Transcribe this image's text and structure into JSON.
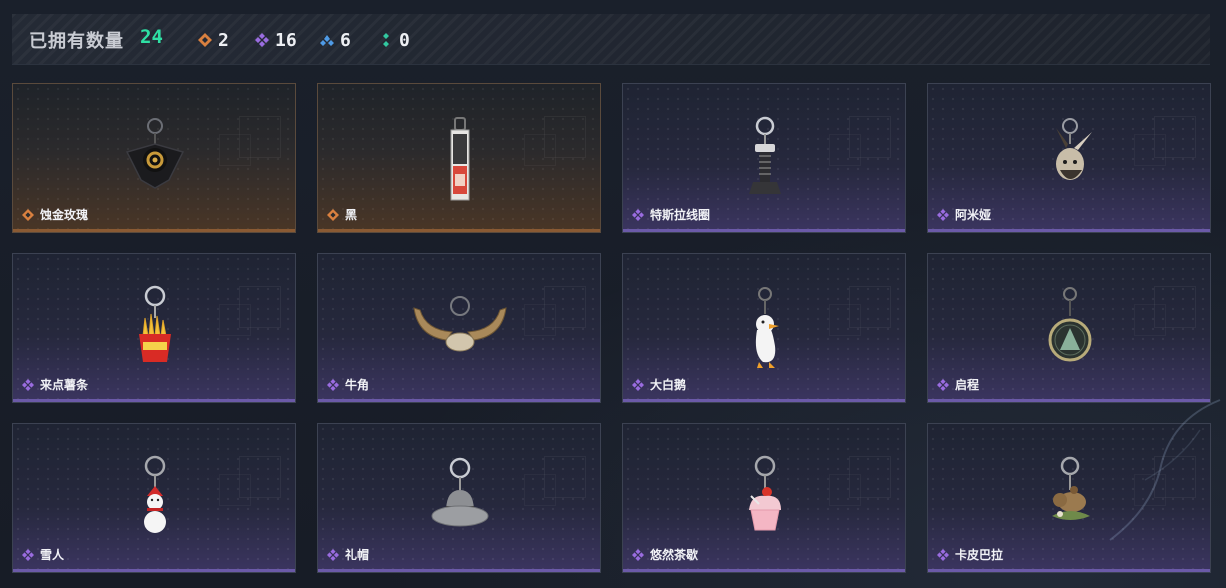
{
  "summary": {
    "label": "已拥有数量",
    "total": "24",
    "rarities": [
      {
        "icon": "orange-rarity-icon",
        "color": "#d9803f",
        "count": "2"
      },
      {
        "icon": "purple-rarity-icon",
        "color": "#9a6ce0",
        "count": "16"
      },
      {
        "icon": "blue-rarity-icon",
        "color": "#4f9be6",
        "count": "6"
      },
      {
        "icon": "green-rarity-icon",
        "color": "#32c8a0",
        "count": "0"
      }
    ]
  },
  "colors": {
    "orange": "#d9803f",
    "purple": "#9a6ce0",
    "accent_green": "#2fe0a4"
  },
  "items": [
    {
      "name": "蚀金玫瑰",
      "rarity": "orange",
      "icon": "black-rose-charm-icon"
    },
    {
      "name": "黑",
      "rarity": "orange",
      "icon": "black-photo-tag-charm-icon"
    },
    {
      "name": "特斯拉线圈",
      "rarity": "purple",
      "icon": "tesla-coil-charm-icon"
    },
    {
      "name": "阿米娅",
      "rarity": "purple",
      "icon": "amiya-charm-icon"
    },
    {
      "name": "来点薯条",
      "rarity": "purple",
      "icon": "fries-charm-icon"
    },
    {
      "name": "牛角",
      "rarity": "purple",
      "icon": "bull-horns-charm-icon"
    },
    {
      "name": "大白鹅",
      "rarity": "purple",
      "icon": "white-goose-charm-icon"
    },
    {
      "name": "启程",
      "rarity": "purple",
      "icon": "departure-medal-charm-icon"
    },
    {
      "name": "雪人",
      "rarity": "purple",
      "icon": "snowman-charm-icon"
    },
    {
      "name": "礼帽",
      "rarity": "purple",
      "icon": "hat-charm-icon"
    },
    {
      "name": "悠然茶歇",
      "rarity": "purple",
      "icon": "cupcake-charm-icon"
    },
    {
      "name": "卡皮巴拉",
      "rarity": "purple",
      "icon": "capybara-charm-icon"
    }
  ]
}
